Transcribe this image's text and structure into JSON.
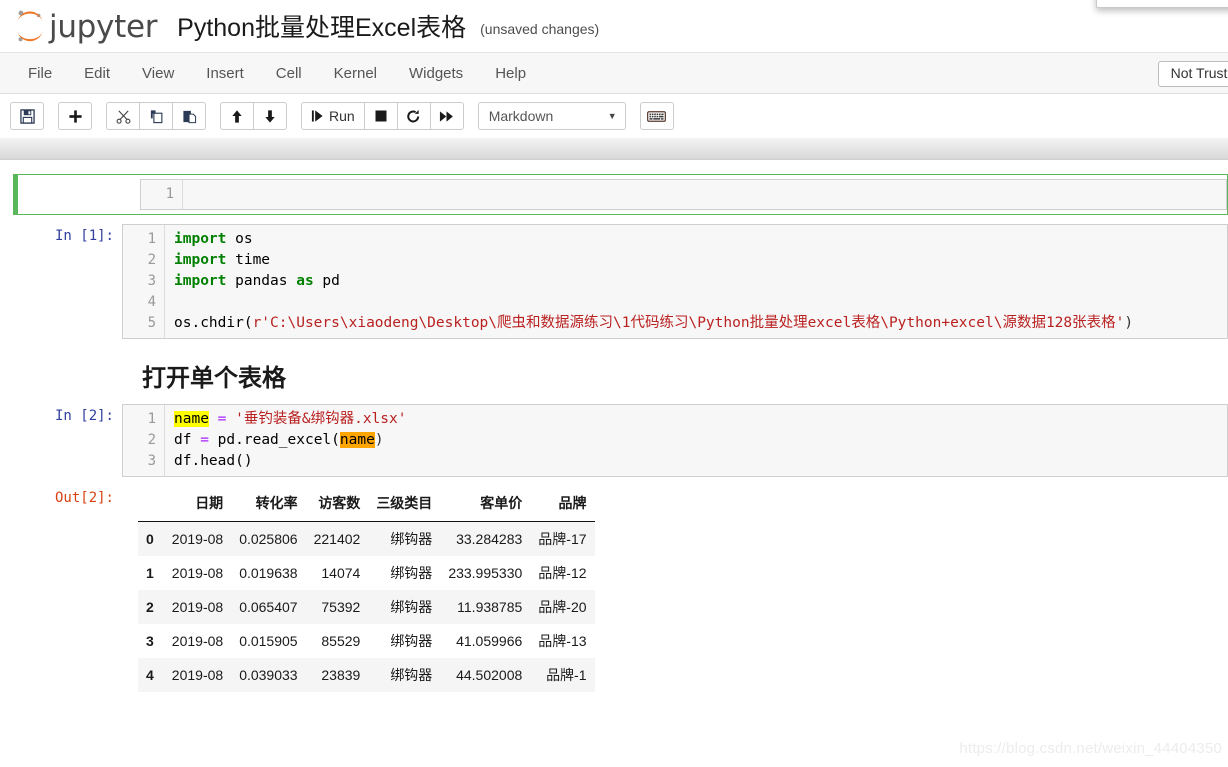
{
  "header": {
    "logo_text": "jupyter",
    "logo_icon": "jupyter-logo-icon",
    "notebook_title": "Python批量处理Excel表格",
    "save_status": "(unsaved changes)"
  },
  "menubar": {
    "items": [
      {
        "label": "File"
      },
      {
        "label": "Edit"
      },
      {
        "label": "View"
      },
      {
        "label": "Insert"
      },
      {
        "label": "Cell"
      },
      {
        "label": "Kernel"
      },
      {
        "label": "Widgets"
      },
      {
        "label": "Help"
      }
    ],
    "trust_label": "Not Trusted"
  },
  "toolbar": {
    "save_icon": "floppy-disk-icon",
    "add_icon": "plus-icon",
    "cut_icon": "scissors-icon",
    "copy_icon": "copy-icon",
    "paste_icon": "paste-icon",
    "move_up_icon": "arrow-up-icon",
    "move_down_icon": "arrow-down-icon",
    "run_icon": "run-step-icon",
    "run_label": "Run",
    "stop_icon": "stop-square-icon",
    "restart_icon": "restart-circle-icon",
    "fastforward_icon": "fast-forward-icon",
    "cell_type_value": "Markdown",
    "cell_type_caret": "chevron-down-icon",
    "keyboard_icon": "keyboard-icon"
  },
  "notebook": {
    "cells": [
      {
        "type": "markdown-empty-selected",
        "prompt": "",
        "line_numbers": [
          "1"
        ],
        "source": ""
      },
      {
        "type": "code",
        "prompt": "In [1]:",
        "line_numbers": [
          "1",
          "2",
          "3",
          "4",
          "5"
        ],
        "lines": {
          "l1_kw": "import",
          "l1_rest": " os",
          "l2_kw": "import",
          "l2_rest": " time",
          "l3_kw": "import",
          "l3_mid": " pandas ",
          "l3_kw2": "as",
          "l3_rest": " pd",
          "l4": "",
          "l5_pre": "os.chdir(",
          "l5_str": "r'C:\\Users\\xiaodeng\\Desktop\\爬虫和数据源练习\\1代码练习\\Python批量处理excel表格\\Python+excel\\源数据128张表格'",
          "l5_post": ")"
        }
      },
      {
        "type": "markdown-heading",
        "heading": "打开单个表格"
      },
      {
        "type": "code",
        "prompt": "In [2]:",
        "line_numbers": [
          "1",
          "2",
          "3"
        ],
        "lines": {
          "l1_var": "name",
          "l1_eq": " = ",
          "l1_str": "'垂钓装备&绑钩器.xlsx'",
          "l2_pre": "df ",
          "l2_eq": "=",
          "l2_mid": " pd.read_excel(",
          "l2_var": "name",
          "l2_post": ")",
          "l3": "df.head()"
        }
      }
    ],
    "output": {
      "prompt": "Out[2]:"
    }
  },
  "chart_data": {
    "type": "table",
    "title": "df.head()",
    "columns": [
      "",
      "日期",
      "转化率",
      "访客数",
      "三级类目",
      "客单价",
      "品牌"
    ],
    "rows": [
      [
        "0",
        "2019-08",
        "0.025806",
        "221402",
        "绑钩器",
        "33.284283",
        "品牌-17"
      ],
      [
        "1",
        "2019-08",
        "0.019638",
        "14074",
        "绑钩器",
        "233.995330",
        "品牌-12"
      ],
      [
        "2",
        "2019-08",
        "0.065407",
        "75392",
        "绑钩器",
        "11.938785",
        "品牌-20"
      ],
      [
        "3",
        "2019-08",
        "0.015905",
        "85529",
        "绑钩器",
        "41.059966",
        "品牌-13"
      ],
      [
        "4",
        "2019-08",
        "0.039033",
        "23839",
        "绑钩器",
        "44.502008",
        "品牌-1"
      ]
    ]
  },
  "watermark": {
    "text": "https://blog.csdn.net/weixin_44404350"
  },
  "colors": {
    "accent_orange": "#F37726",
    "keyword_green": "#008000",
    "string_red": "#BA2121",
    "operator_purple": "#AA22FF",
    "prompt_blue": "#303F9F",
    "prompt_red": "#D84315",
    "selected_green": "#5BB75B",
    "highlight_yellow": "#FFFF00",
    "highlight_orange": "#FFA500"
  }
}
